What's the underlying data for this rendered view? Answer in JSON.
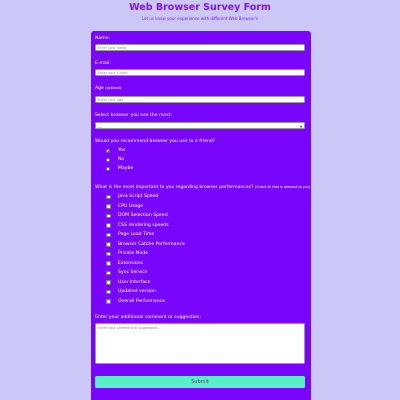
{
  "header": {
    "title": "Web Browser Survey Form",
    "subtitle": "Let us know your experience with different Web Browser's"
  },
  "form": {
    "name_label": "Name:",
    "name_placeholder": "Enter your name",
    "email_label": "E-mail:",
    "email_placeholder": "Enter your E-mail",
    "age_label": "Age",
    "age_note": "(optional):",
    "age_placeholder": "Enter your age",
    "browser_label": "Select browser you use the most:",
    "browser_selected": "---",
    "recommend_label": "Would you recommend browser you use to a friend?",
    "recommend_options": [
      "Yes",
      "No",
      "Maybe"
    ],
    "recommend_selected": "Yes",
    "performance_label": "What is the most important to you regarding browser performances?",
    "performance_note": "(Check all that is relevant to you)",
    "performance_options": [
      "Java Script Speed",
      "CPU Usage",
      "DOM Selection Speed",
      "CSS rendering speeds",
      "Page Load Time",
      "Browser Catche Performance",
      "Private Mode",
      "Extensions",
      "Sync Service",
      "User Interface",
      "Updated version",
      "Overall Performance"
    ],
    "comment_label": "Enter your additional comment or suggestion:",
    "comment_placeholder": "Enter your comment or suggestion...",
    "submit_label": "Submit"
  },
  "colors": {
    "page_background": "#cbc8f7",
    "form_background": "#7a05fc",
    "title_color": "#7d12ff",
    "submit_background": "#57f0c4"
  }
}
